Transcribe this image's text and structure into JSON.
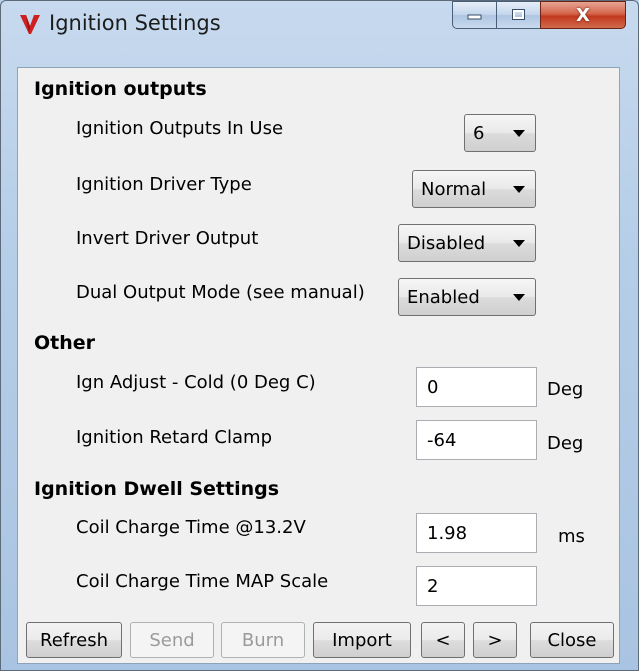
{
  "window": {
    "title": "Ignition Settings",
    "close_glyph": "X"
  },
  "sections": {
    "outputs": {
      "title": "Ignition outputs",
      "in_use": {
        "label": "Ignition Outputs In Use",
        "value": "6"
      },
      "driver_type": {
        "label": "Ignition Driver Type",
        "value": "Normal"
      },
      "invert": {
        "label": "Invert Driver Output",
        "value": "Disabled"
      },
      "dual": {
        "label": "Dual Output Mode (see manual)",
        "value": "Enabled"
      }
    },
    "other": {
      "title": "Other",
      "cold_adjust": {
        "label": "Ign Adjust - Cold (0 Deg C)",
        "value": "0",
        "unit": "Deg"
      },
      "retard_clamp": {
        "label": "Ignition Retard Clamp",
        "value": "-64",
        "unit": "Deg"
      }
    },
    "dwell": {
      "title": "Ignition Dwell Settings",
      "charge_time": {
        "label": "Coil Charge Time @13.2V",
        "value": "1.98",
        "unit": "ms"
      },
      "map_scale": {
        "label": "Coil Charge Time MAP Scale",
        "value": "2"
      }
    }
  },
  "buttons": {
    "refresh": "Refresh",
    "send": "Send",
    "burn": "Burn",
    "import": "Import",
    "prev": "<",
    "next": ">",
    "close": "Close"
  },
  "colors": {
    "app_icon": "#d01f1f",
    "window_frame": "#b4cde8",
    "close_button": "#c2391e"
  }
}
